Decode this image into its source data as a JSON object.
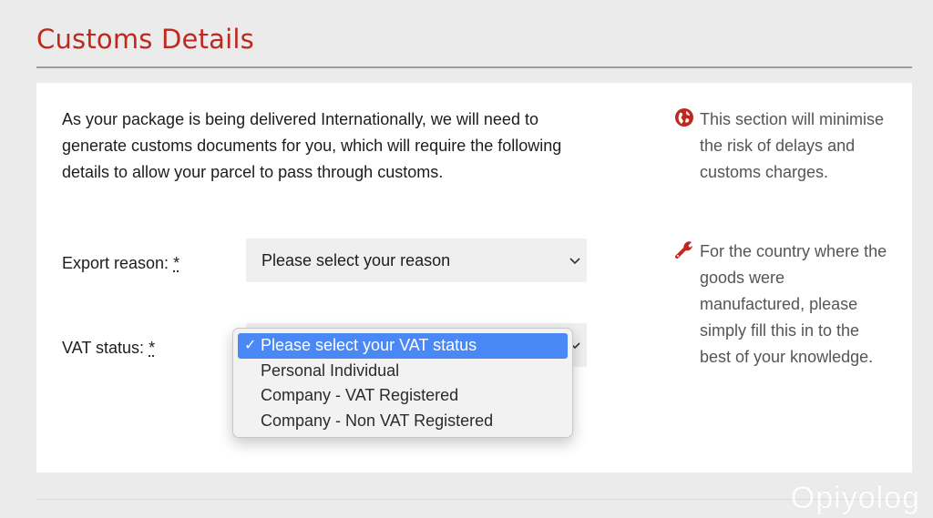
{
  "page": {
    "title": "Customs Details"
  },
  "intro": "As your package is being delivered Internationally, we will need to generate customs documents for you, which will require the following details to allow your parcel to pass through customs.",
  "form": {
    "export_reason": {
      "label": "Export reason:",
      "required_mark": "*",
      "value": "Please select your reason"
    },
    "vat_status": {
      "label": "VAT status:",
      "required_mark": "*",
      "options": [
        "Please select your VAT status",
        "Personal Individual",
        "Company - VAT Registered",
        "Company - Non VAT Registered"
      ],
      "selected_index": 0,
      "check_glyph": "✓"
    }
  },
  "tips": [
    {
      "icon": "globe-icon",
      "text": "This section will minimise the risk of delays and customs charges."
    },
    {
      "icon": "wrench-icon",
      "text": "For the country where the goods were manufactured, please simply fill this in to the best of your knowledge."
    }
  ],
  "watermark": "Opiyolog",
  "colors": {
    "brand_red": "#c0281e",
    "selection_blue": "#4a88f5"
  }
}
